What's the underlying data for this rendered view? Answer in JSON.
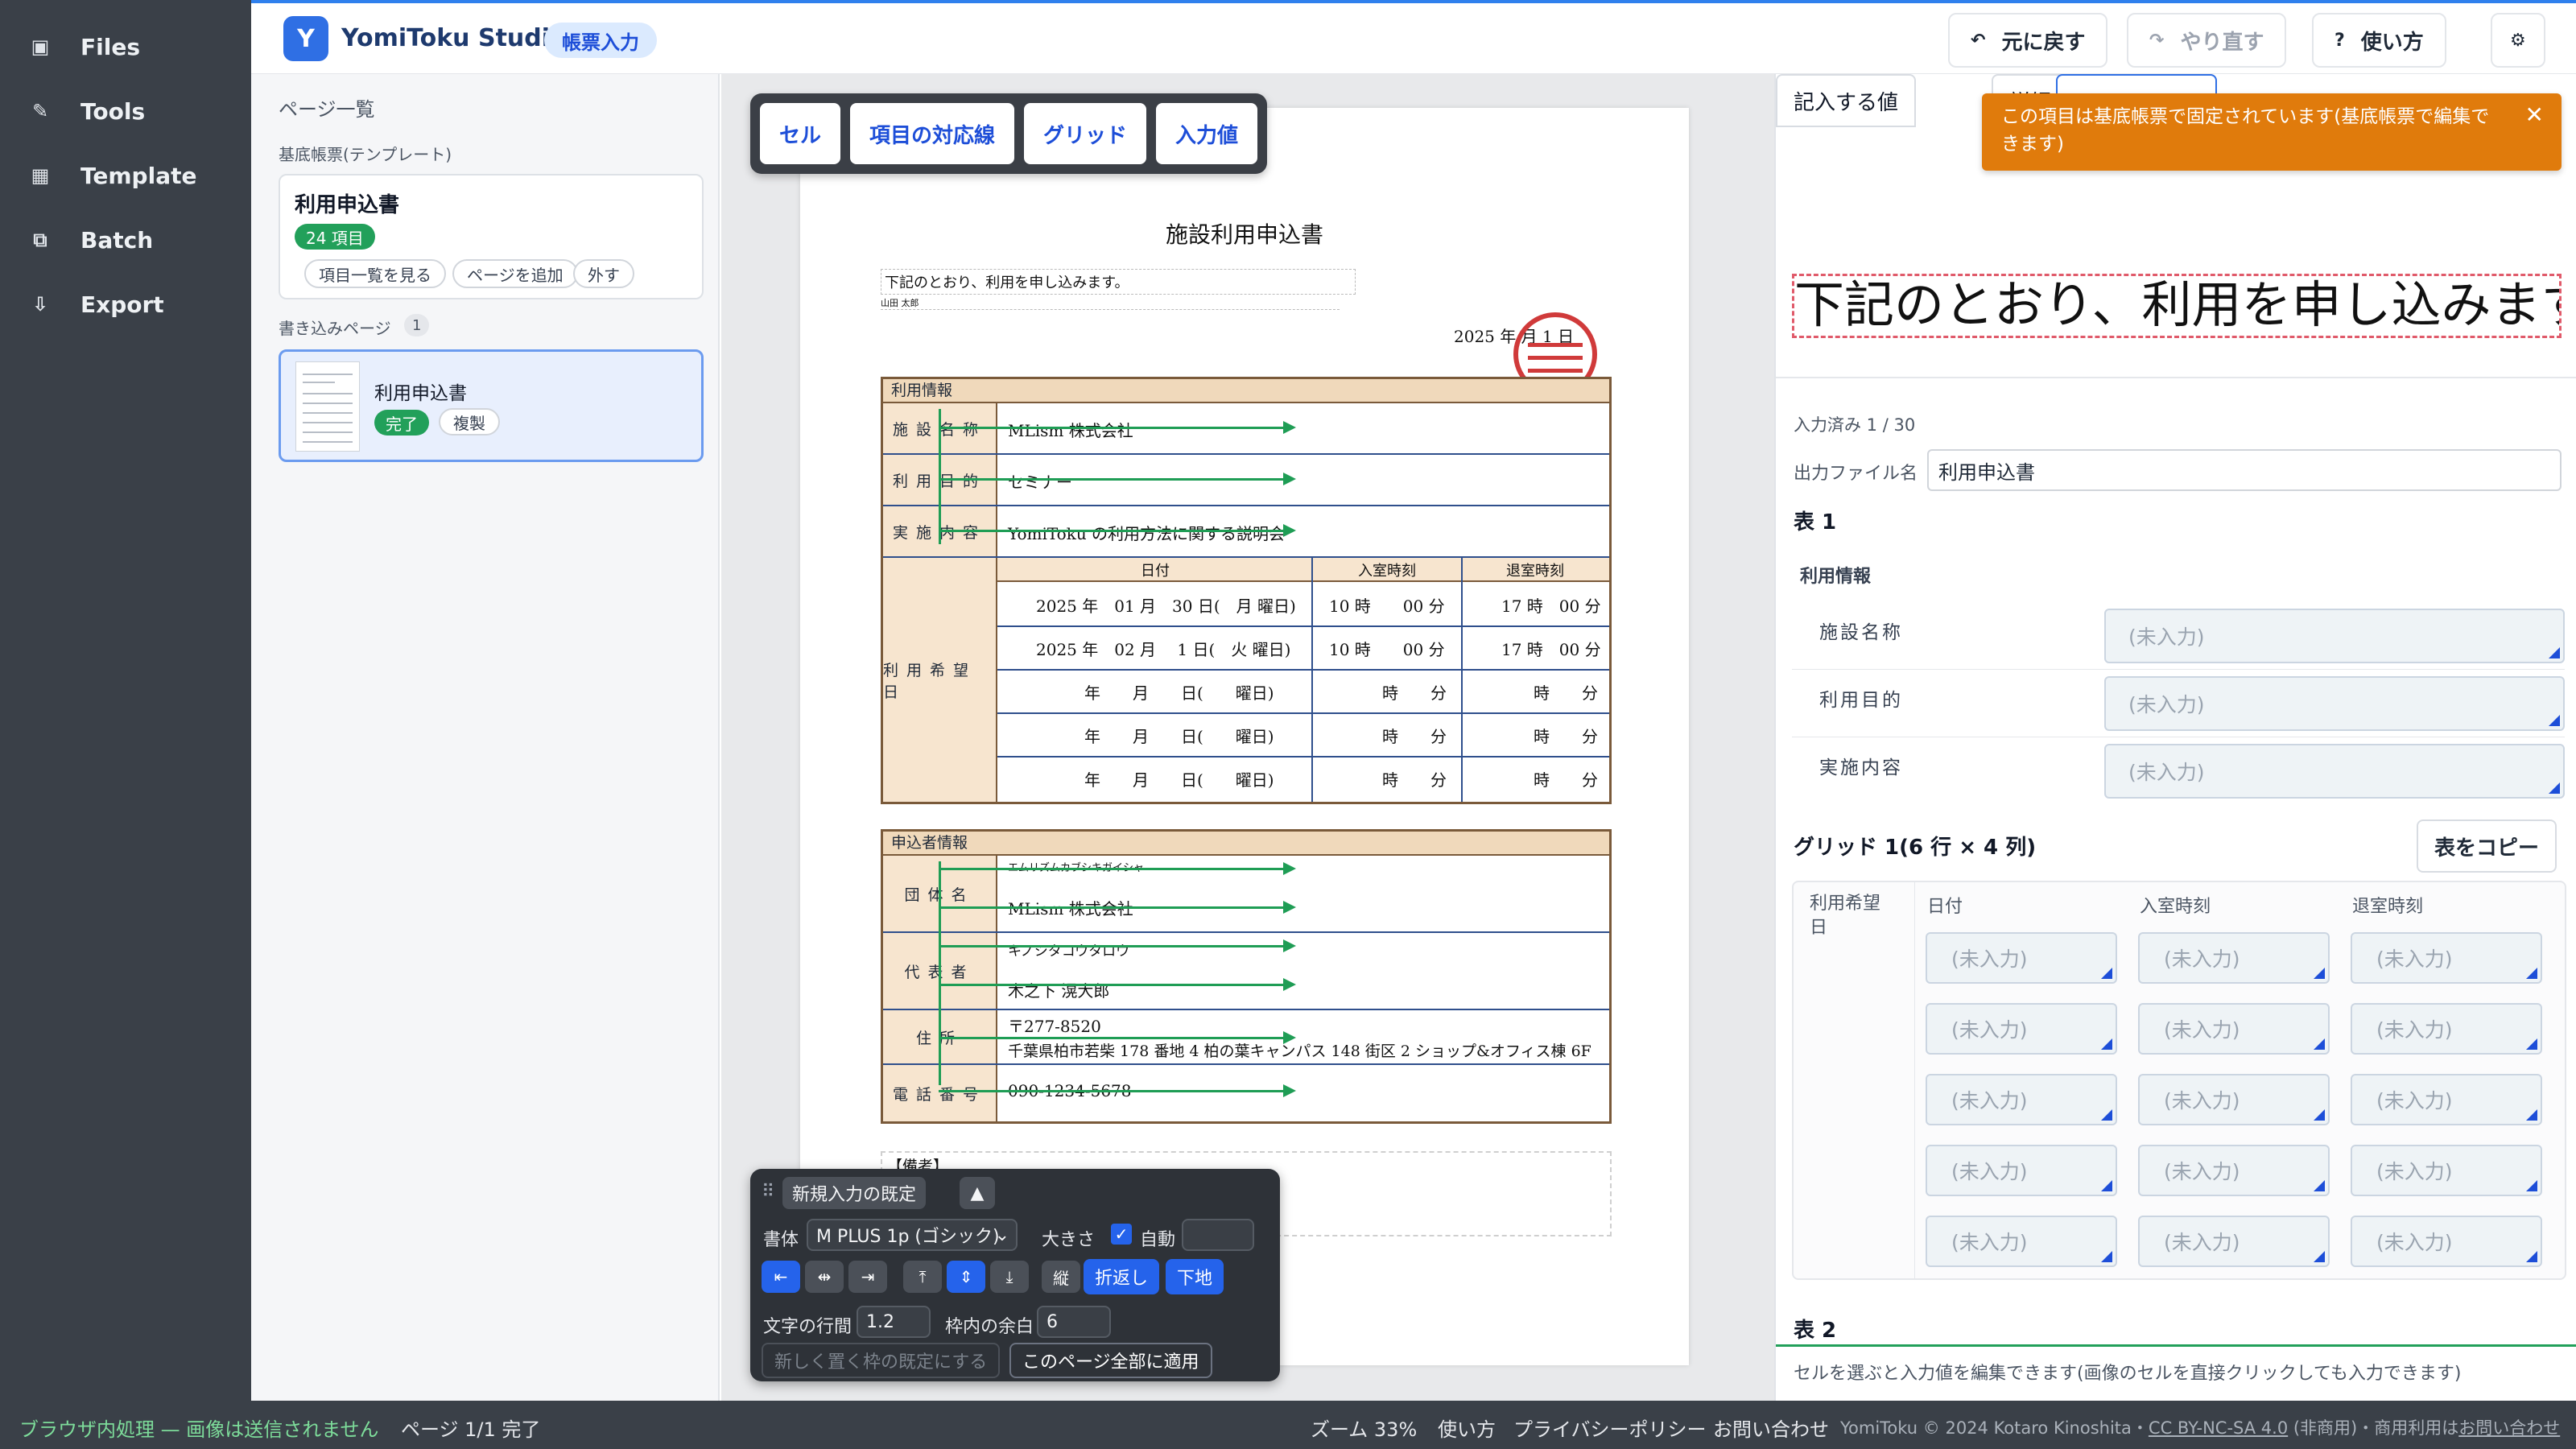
{
  "sidebar": {
    "items": [
      {
        "label": "Files",
        "icon": "file-icon"
      },
      {
        "label": "Tools",
        "icon": "pencil-icon"
      },
      {
        "label": "Template",
        "icon": "grid-icon"
      },
      {
        "label": "Batch",
        "icon": "layers-icon"
      },
      {
        "label": "Export",
        "icon": "download-icon"
      }
    ]
  },
  "header": {
    "logo": "Y",
    "title": "YomiToku Studio",
    "mode": "帳票入力",
    "undo": "元に戻す",
    "redo": "やり直す",
    "help": "使い方",
    "undo_icon": "↶",
    "redo_icon": "↷",
    "help_icon": "?",
    "settings_icon": "⚙"
  },
  "pages_panel": {
    "heading": "ページ一覧",
    "template_label": "基底帳票(テンプレート)",
    "template": {
      "title": "利用申込書",
      "badge": "24 項目",
      "buttons": [
        "項目一覧を見る",
        "ページを追加",
        "外す"
      ]
    },
    "entry_label": "書き込みページ",
    "entry_count": "1",
    "page": {
      "title": "利用申込書",
      "status": "完了",
      "duplicate": "複製"
    }
  },
  "canvas": {
    "toolbar": [
      "セル",
      "項目の対応線",
      "グリッド",
      "入力値"
    ],
    "doc": {
      "title": "施設利用申込書",
      "intro": "下記のとおり、利用を申し込みます。",
      "name_line": "山田 太郎",
      "date": "2025 年 月 1 日",
      "usage_section": "利用情報",
      "rows": [
        {
          "label": "施設名称",
          "value": "MLism 株式会社"
        },
        {
          "label": "利用目的",
          "value": "セミナー"
        },
        {
          "label": "実施内容",
          "value": "YomiToku の利用方法に関する説明会"
        }
      ],
      "date_label": "利用希望日",
      "grid_headers": [
        "日付",
        "入室時刻",
        "退室時刻"
      ],
      "grid_rows": [
        [
          "2025 年　01 月　30 日(　月 曜日)",
          "10 時　　00 分",
          "17 時　00 分"
        ],
        [
          "2025 年　02 月　 1 日(　火 曜日)",
          "10 時　　00 分",
          "17 時　00 分"
        ],
        [
          "年　　月　　日(　　曜日)",
          "時　　分",
          "時　　分"
        ],
        [
          "年　　月　　日(　　曜日)",
          "時　　分",
          "時　　分"
        ],
        [
          "年　　月　　日(　　曜日)",
          "時　　分",
          "時　　分"
        ]
      ],
      "applicant_section": "申込者情報",
      "applicant_rows": [
        {
          "label": "団体名",
          "kana": "エムリズムカブシキガイシャ",
          "value": "MLism 株式会社"
        },
        {
          "label": "代表者",
          "kana": "キノシタコウタロウ",
          "value": "木之下 滉大郎"
        },
        {
          "label": "住所",
          "kana": "〒277-8520",
          "value": "千葉県柏市若柴 178 番地 4 柏の葉キャンパス 148 街区 2 ショップ&オフィス棟 6F"
        },
        {
          "label": "電話番号",
          "kana": "",
          "value": "090-1234-5678"
        }
      ],
      "remarks": "【備考】"
    },
    "style_panel": {
      "title": "新規入力の既定",
      "font_label": "書体",
      "font_value": "M PLUS 1p (ゴシック)",
      "size_label": "大きさ",
      "auto_label": "自動",
      "vertical": "縦",
      "wrap": "折返し",
      "baseline": "下地",
      "line_label": "文字の行間",
      "line_value": "1.2",
      "pad_label": "枠内の余白",
      "pad_value": "6",
      "default_btn": "新しく置く枠の既定にする",
      "apply_btn": "このページ全部に適用",
      "icons": [
        "⇤",
        "⇹",
        "⇥",
        "⤒",
        "⇕",
        "⤓"
      ]
    }
  },
  "right_panel": {
    "tabs": [
      "記入する値",
      "詳細"
    ],
    "toast": "この項目は基底帳票で固定されています(基底帳票で編集できます)",
    "preview_text": "下記のとおり、利用を申し込みます。",
    "progress": "入力済み 1 / 30",
    "filename_label": "出力ファイル名",
    "filename_value": "利用申込書",
    "table1": "表 1",
    "group": "利用情報",
    "fields": [
      "施設名称",
      "利用目的",
      "実施内容"
    ],
    "placeholder": "(未入力)",
    "grid_title": "グリッド 1(6 行 × 4 列)",
    "copy_btn": "表をコピー",
    "grid_headers": [
      "利用希望日",
      "日付",
      "入室時刻",
      "退室時刻"
    ],
    "table2": "表 2",
    "hint": "セルを選ぶと入力値を編集できます(画像のセルを直接クリックしても入力できます)"
  },
  "status_bar": {
    "local": "ブラウザ内処理 — 画像は送信されません",
    "pages": "ページ 1/1 完了",
    "zoom": "ズーム 33%",
    "help": "使い方",
    "privacy": "プライバシーポリシー",
    "contact": "お問い合わせ",
    "credit": "YomiToku © 2024 Kotaro Kinoshita・",
    "license": "CC BY-NC-SA 4.0",
    "license_note": " (非商用)・商用利用は",
    "commercial": "お問い合わせ"
  },
  "colors": {
    "accent": "#2f6fe4",
    "sidebar": "#3a4048",
    "success": "#22a05a",
    "toast": "#e07b0c",
    "arrow": "#1f9d55"
  }
}
